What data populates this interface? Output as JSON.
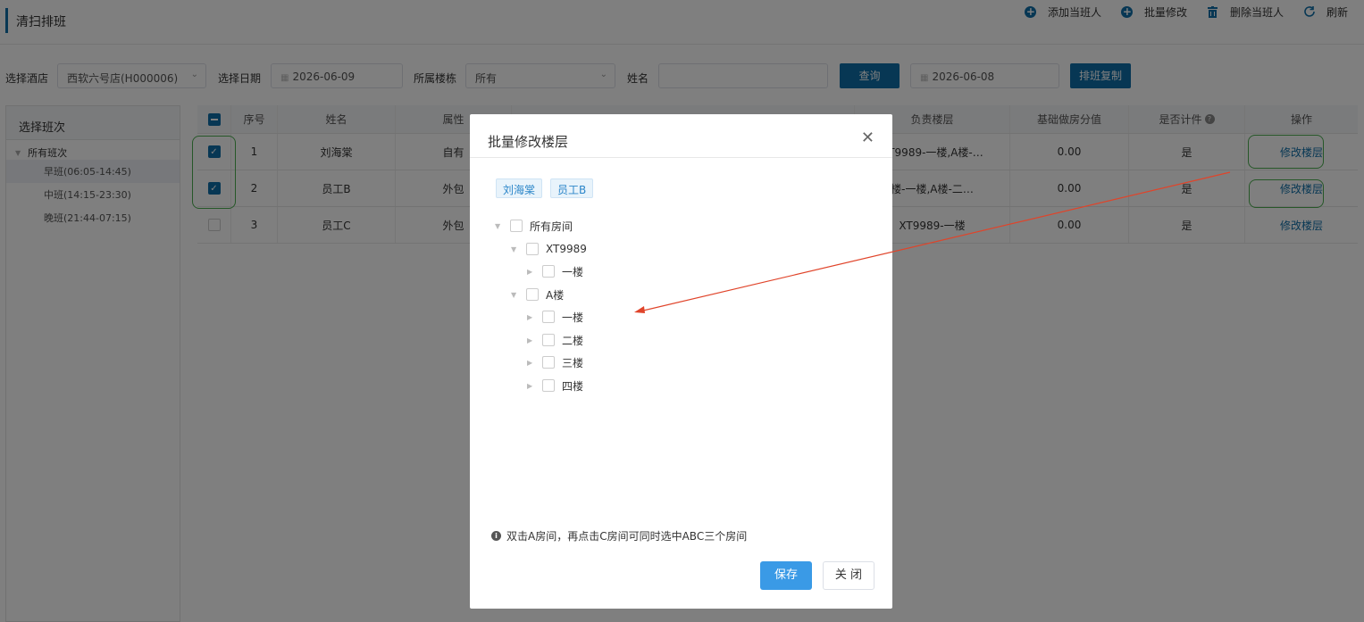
{
  "header": {
    "title": "清扫排班",
    "toolbar": [
      {
        "icon": "plus-circle-icon",
        "label": "添加当班人"
      },
      {
        "icon": "plus-circle-icon",
        "label": "批量修改"
      },
      {
        "icon": "trash-icon",
        "label": "删除当班人"
      },
      {
        "icon": "refresh-icon",
        "label": "刷新"
      }
    ]
  },
  "filters": {
    "hotel_label": "选择酒店",
    "hotel_value": "西软六号店(H000006)",
    "date_label": "选择日期",
    "date_value": "2026-06-09",
    "building_label": "所属楼栋",
    "building_value": "所有",
    "name_label": "姓名",
    "name_value": "",
    "query_button": "查询",
    "copy_date": "2026-06-08",
    "copy_button": "排班复制"
  },
  "shifts": {
    "heading": "选择班次",
    "root": "所有班次",
    "items": [
      "早班(06:05-14:45)",
      "中班(14:15-23:30)",
      "晚班(21:44-07:15)"
    ]
  },
  "table": {
    "headers": [
      "序号",
      "姓名",
      "属性",
      "负责楼层",
      "基础做房分值",
      "是否计件",
      "操作"
    ],
    "rows": [
      {
        "no": "1",
        "name": "刘海棠",
        "attr": "自有",
        "floors": "XT9989-一楼,A楼-…",
        "score": "0.00",
        "piece": "是",
        "action": "修改楼层",
        "checked": true
      },
      {
        "no": "2",
        "name": "员工B",
        "attr": "外包",
        "floors": "楼-一楼,A楼-二…",
        "score": "0.00",
        "piece": "是",
        "action": "修改楼层",
        "checked": true
      },
      {
        "no": "3",
        "name": "员工C",
        "attr": "外包",
        "floors": "XT9989-一楼",
        "score": "0.00",
        "piece": "是",
        "action": "修改楼层",
        "checked": false
      }
    ]
  },
  "modal": {
    "title": "批量修改楼层",
    "tags": [
      "刘海棠",
      "员工B"
    ],
    "tree": {
      "root": "所有房间",
      "buildings": [
        {
          "name": "XT9989",
          "floors": [
            "一楼"
          ]
        },
        {
          "name": "A楼",
          "floors": [
            "一楼",
            "二楼",
            "三楼",
            "四楼"
          ]
        }
      ]
    },
    "hint": "双击A房间，再点击C房间可同时选中ABC三个房间",
    "save": "保存",
    "close": "关 闭"
  },
  "colors": {
    "primary": "#0f6fa8",
    "save": "#3a9ae6",
    "highlight": "#4caf50",
    "arrow": "#e0442a"
  }
}
